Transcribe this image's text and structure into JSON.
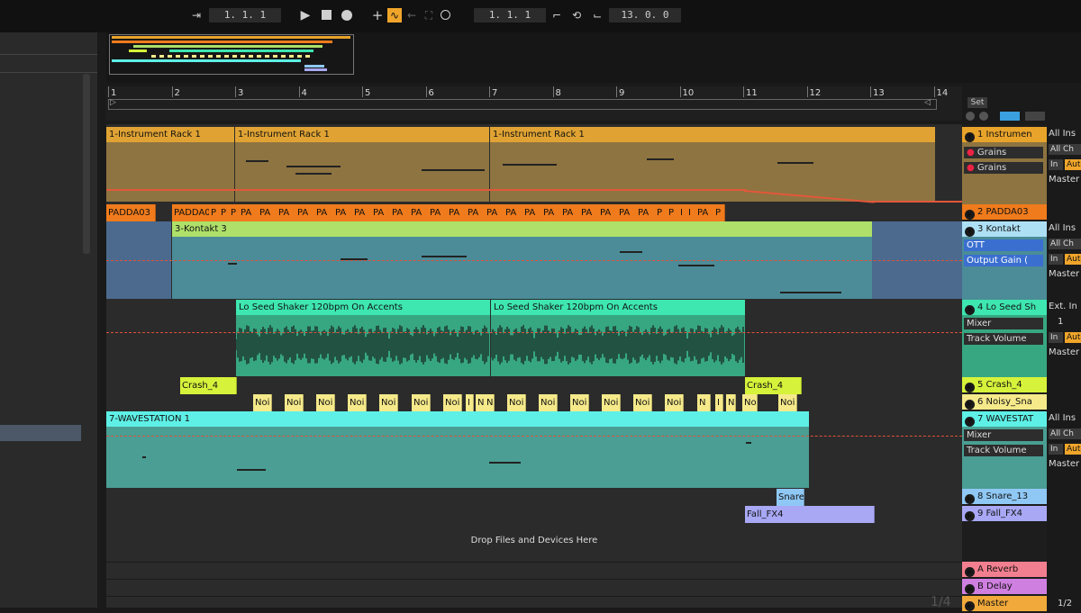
{
  "transport": {
    "arrangement_position": "1.   1.   1",
    "loop_start": "1.   1.   1",
    "loop_length": "13.   0.   0",
    "icons": [
      "follow-icon",
      "play-icon",
      "stop-icon",
      "record-icon",
      "add-icon",
      "draw-mode-icon",
      "back-icon",
      "capture-icon",
      "loop-icon"
    ]
  },
  "ruler": {
    "bars": [
      "1",
      "2",
      "3",
      "4",
      "5",
      "6",
      "7",
      "8",
      "9",
      "10",
      "11",
      "12",
      "13",
      "14"
    ]
  },
  "arrangement": {
    "tracks": [
      {
        "clips": [
          "1-Instrument Rack 1",
          "1-Instrument Rack 1",
          "1-Instrument Rack 1"
        ]
      },
      {
        "clips": [
          "PADDA03",
          "PADDA0:",
          "P",
          "P",
          "P",
          "PA",
          "PA",
          "PA",
          "PA",
          "PA",
          "PA",
          "PA",
          "PA",
          "PA",
          "PA",
          "PA",
          "PA",
          "PA",
          "PA",
          "PA",
          "PA",
          "PA",
          "PA",
          "PA",
          "PA",
          "PA",
          "PA",
          "P",
          "P",
          "I",
          "I",
          "PA",
          "P"
        ]
      },
      {
        "clips": [
          "3-Kontakt 3"
        ]
      },
      {
        "clips": [
          "Lo Seed Shaker 120bpm On Accents",
          "Lo Seed Shaker 120bpm On Accents"
        ]
      },
      {
        "clips": [
          "Crash_4",
          "Crash_4"
        ]
      },
      {
        "clips": [
          "Noi",
          "Noi",
          "Noi",
          "Noi",
          "Noi",
          "Noi",
          "Noi",
          "I",
          "N",
          "N",
          "Noi",
          "Noi",
          "Noi",
          "Noi",
          "Noi",
          "Noi",
          "N",
          "I",
          "N",
          "No",
          "Noi"
        ]
      },
      {
        "clips": [
          "7-WAVESTATION 1"
        ]
      },
      {
        "clips": [
          "Snare"
        ]
      },
      {
        "clips": [
          "Fall_FX4"
        ]
      }
    ],
    "drop_hint": "Drop Files and Devices Here",
    "zoom": "1/4"
  },
  "set_button": "Set",
  "heads": [
    {
      "name": "1 Instrumen",
      "color": "#e8a32a",
      "devices": [
        "Grains",
        "Grains"
      ]
    },
    {
      "name": "2 PADDA03",
      "color": "#f07b1c"
    },
    {
      "name": "3 Kontakt",
      "color": "#aee0f5",
      "devices": [
        "OTT",
        "Output Gain ("
      ]
    },
    {
      "name": "4 Lo Seed Sh",
      "color": "#3ee6b0",
      "devices": [
        "Mixer",
        "Track Volume"
      ]
    },
    {
      "name": "5 Crash_4",
      "color": "#d6f23a"
    },
    {
      "name": "6 Noisy_Sna",
      "color": "#f5e98a"
    },
    {
      "name": "7 WAVESTAT",
      "color": "#5ef0e6",
      "devices": [
        "Mixer",
        "Track Volume"
      ]
    },
    {
      "name": "8 Snare_13",
      "color": "#8fc8f5"
    },
    {
      "name": "9 Fall_FX4",
      "color": "#a8a8f5"
    },
    {
      "name": "A Reverb",
      "color": "#f27f8f"
    },
    {
      "name": "B Delay",
      "color": "#cf7fe0"
    },
    {
      "name": "Master",
      "color": "#f0a93a"
    }
  ],
  "io": {
    "all_ins": "All Ins",
    "all_channels": "All Ch",
    "ext_in": "Ext. In",
    "in": "In",
    "auto": "Auto",
    "master": "Master",
    "one": "1",
    "half": "1/2"
  }
}
